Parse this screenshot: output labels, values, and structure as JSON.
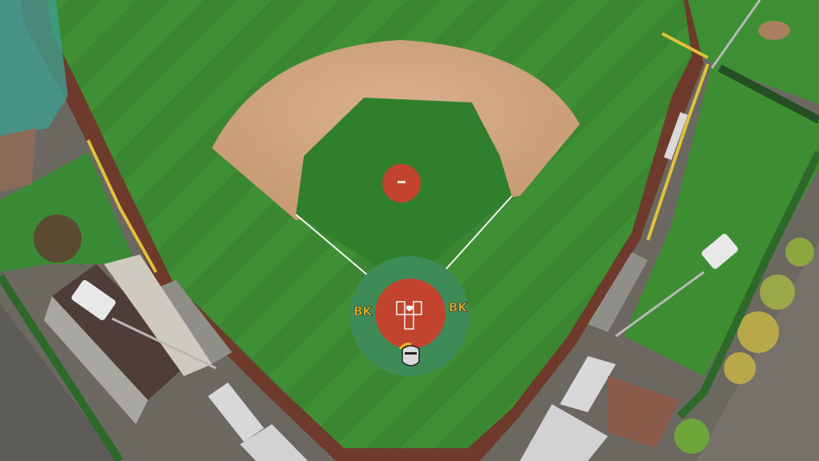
{
  "image": {
    "subject": "aerial-baseball-field",
    "field_logos": [
      "BK",
      "BK"
    ],
    "colors": {
      "grass": "#3f8f34",
      "grass_dark": "#2f7a2c",
      "infield_dirt": "#cfa27f",
      "warning_track": "#7a3b2a",
      "mound_clay": "#c2442f",
      "home_circle": "#3f8f5a",
      "logo_gold": "#e8b524"
    }
  }
}
